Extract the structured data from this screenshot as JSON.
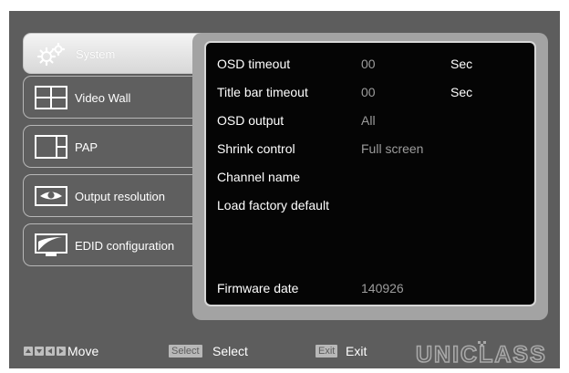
{
  "sidebar": {
    "tabs": [
      {
        "label": "System",
        "icon": "gears-icon",
        "active": true
      },
      {
        "label": "Video Wall",
        "icon": "video-wall-icon",
        "active": false
      },
      {
        "label": "PAP",
        "icon": "pap-icon",
        "active": false
      },
      {
        "label": "Output resolution",
        "icon": "eye-icon",
        "active": false
      },
      {
        "label": "EDID configuration",
        "icon": "monitor-icon",
        "active": false
      }
    ]
  },
  "settings": {
    "rows": [
      {
        "label": "OSD timeout",
        "value": "00",
        "unit": "Sec"
      },
      {
        "label": "Title bar timeout",
        "value": "00",
        "unit": "Sec"
      },
      {
        "label": "OSD output",
        "value": "All",
        "unit": ""
      },
      {
        "label": "Shrink control",
        "value": "Full screen",
        "unit": ""
      },
      {
        "label": "Channel name",
        "value": "",
        "unit": ""
      },
      {
        "label": "Load factory default",
        "value": "",
        "unit": ""
      }
    ],
    "firmware": {
      "label": "Firmware date",
      "value": "140926"
    }
  },
  "footer": {
    "move_label": "Move",
    "select_key": "Select",
    "select_label": "Select",
    "exit_key": "Exit",
    "exit_label": "Exit",
    "brand": "UNICLASS"
  },
  "colors": {
    "screen_background": "#5d5d5d",
    "content_background": "#050505",
    "value_text": "#9c9c9c"
  }
}
